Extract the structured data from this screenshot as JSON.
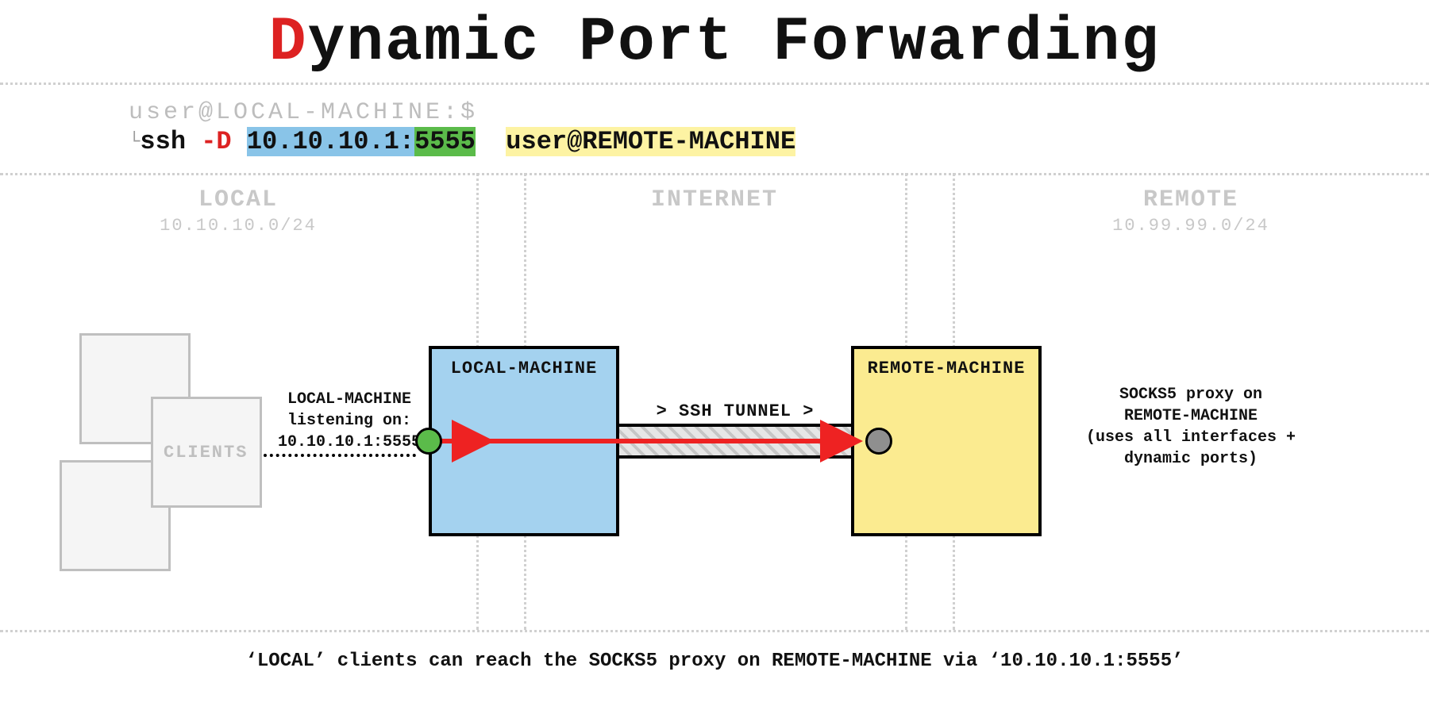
{
  "title": {
    "accent": "D",
    "rest": "ynamic Port Forwarding"
  },
  "prompt": "user@LOCAL-MACHINE:$",
  "command": {
    "cmd": "ssh ",
    "flag": "-D",
    "ip": "10.10.10.1",
    "colon": ":",
    "port": "5555",
    "target": "user@REMOTE-MACHINE"
  },
  "zones": {
    "local": {
      "title": "LOCAL",
      "subnet": "10.10.10.0/24"
    },
    "inet": {
      "title": "INTERNET"
    },
    "remote": {
      "title": "REMOTE",
      "subnet": "10.99.99.0/24"
    }
  },
  "clients_label": "CLIENTS",
  "machines": {
    "local": "LOCAL-MACHINE",
    "remote": "REMOTE-MACHINE"
  },
  "tunnel_label": "> SSH TUNNEL >",
  "listening_note": "LOCAL-MACHINE\nlistening on:\n10.10.10.1:5555",
  "remote_note": "SOCKS5 proxy on\nREMOTE-MACHINE\n(uses all interfaces +\ndynamic ports)",
  "caption": "‘LOCAL’ clients can reach the SOCKS5 proxy on REMOTE-MACHINE via ‘10.10.10.1:5555’"
}
